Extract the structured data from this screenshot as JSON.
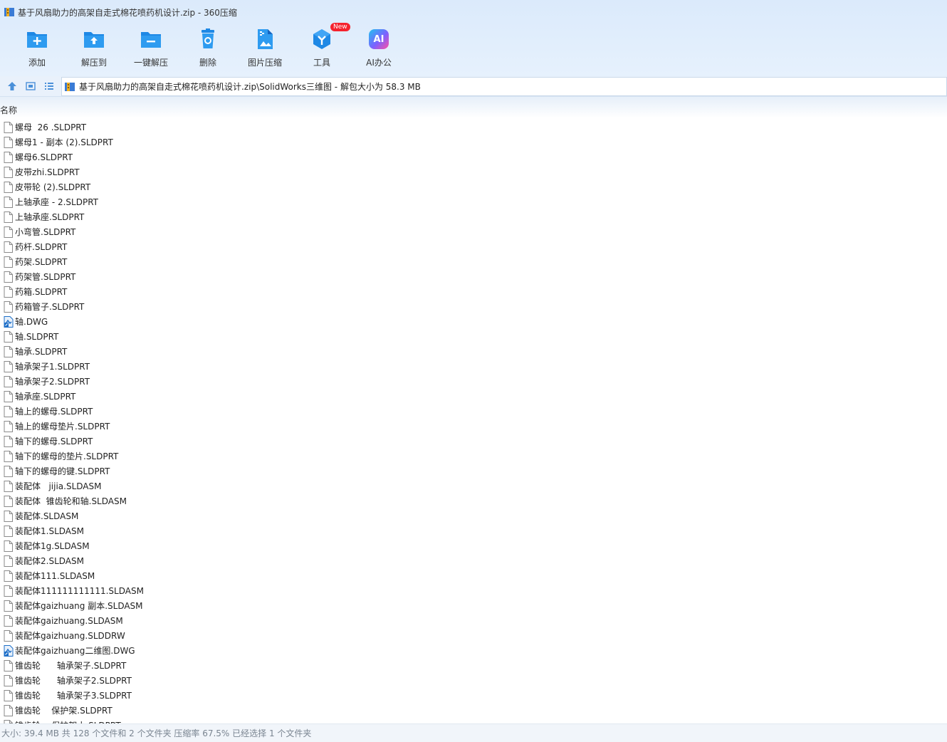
{
  "window": {
    "title": "基于风扇助力的高架自走式棉花喷药机设计.zip - 360压缩"
  },
  "toolbar": {
    "items": [
      {
        "label": "添加",
        "icon": "add-icon"
      },
      {
        "label": "解压到",
        "icon": "extract-to-icon"
      },
      {
        "label": "一键解压",
        "icon": "one-click-extract-icon"
      },
      {
        "label": "删除",
        "icon": "delete-icon"
      },
      {
        "label": "图片压缩",
        "icon": "image-compress-icon"
      },
      {
        "label": "工具",
        "icon": "tools-icon",
        "badge": "New"
      },
      {
        "label": "AI办公",
        "icon": "ai-office-icon",
        "glyph": "AI"
      }
    ]
  },
  "address": {
    "path": "基于风扇助力的高架自走式棉花喷药机设计.zip\\SolidWorks三维图 - 解包大小为 58.3 MB"
  },
  "list": {
    "column_name": "名称",
    "files": [
      {
        "name": "螺母  26 .SLDPRT",
        "type": "file"
      },
      {
        "name": "螺母1 - 副本 (2).SLDPRT",
        "type": "file"
      },
      {
        "name": "螺母6.SLDPRT",
        "type": "file"
      },
      {
        "name": "皮带zhi.SLDPRT",
        "type": "file"
      },
      {
        "name": "皮带轮 (2).SLDPRT",
        "type": "file"
      },
      {
        "name": "上轴承座 - 2.SLDPRT",
        "type": "file"
      },
      {
        "name": "上轴承座.SLDPRT",
        "type": "file"
      },
      {
        "name": "小弯管.SLDPRT",
        "type": "file"
      },
      {
        "name": "药杆.SLDPRT",
        "type": "file"
      },
      {
        "name": "药架.SLDPRT",
        "type": "file"
      },
      {
        "name": "药架管.SLDPRT",
        "type": "file"
      },
      {
        "name": "药箱.SLDPRT",
        "type": "file"
      },
      {
        "name": "药箱管子.SLDPRT",
        "type": "file"
      },
      {
        "name": "轴.DWG",
        "type": "dwg"
      },
      {
        "name": "轴.SLDPRT",
        "type": "file"
      },
      {
        "name": "轴承.SLDPRT",
        "type": "file"
      },
      {
        "name": "轴承架子1.SLDPRT",
        "type": "file"
      },
      {
        "name": "轴承架子2.SLDPRT",
        "type": "file"
      },
      {
        "name": "轴承座.SLDPRT",
        "type": "file"
      },
      {
        "name": "轴上的螺母.SLDPRT",
        "type": "file"
      },
      {
        "name": "轴上的螺母垫片.SLDPRT",
        "type": "file"
      },
      {
        "name": "轴下的螺母.SLDPRT",
        "type": "file"
      },
      {
        "name": "轴下的螺母的垫片.SLDPRT",
        "type": "file"
      },
      {
        "name": "轴下的螺母的键.SLDPRT",
        "type": "file"
      },
      {
        "name": "装配体   jijia.SLDASM",
        "type": "file"
      },
      {
        "name": "装配体  锥齿轮和轴.SLDASM",
        "type": "file"
      },
      {
        "name": "装配体.SLDASM",
        "type": "file"
      },
      {
        "name": "装配体1.SLDASM",
        "type": "file"
      },
      {
        "name": "装配体1g.SLDASM",
        "type": "file"
      },
      {
        "name": "装配体2.SLDASM",
        "type": "file"
      },
      {
        "name": "装配体111.SLDASM",
        "type": "file"
      },
      {
        "name": "装配体111111111111.SLDASM",
        "type": "file"
      },
      {
        "name": "装配体gaizhuang 副本.SLDASM",
        "type": "file"
      },
      {
        "name": "装配体gaizhuang.SLDASM",
        "type": "file"
      },
      {
        "name": "装配体gaizhuang.SLDDRW",
        "type": "file"
      },
      {
        "name": "装配体gaizhuang二维图.DWG",
        "type": "dwg"
      },
      {
        "name": "锥齿轮      轴承架子.SLDPRT",
        "type": "file"
      },
      {
        "name": "锥齿轮      轴承架子2.SLDPRT",
        "type": "file"
      },
      {
        "name": "锥齿轮      轴承架子3.SLDPRT",
        "type": "file"
      },
      {
        "name": "锥齿轮    保护架.SLDPRT",
        "type": "file"
      },
      {
        "name": "锥齿轮    保护架小.SLDPRT",
        "type": "file"
      }
    ]
  },
  "status": {
    "text": "大小: 39.4 MB 共 128 个文件和 2 个文件夹 压缩率 67.5% 已经选择 1 个文件夹"
  },
  "colors": {
    "accent": "#1e88e5",
    "toolbar_bg": "#dbeafb",
    "status_text": "#7a8591",
    "new_badge": "#f5222d"
  }
}
